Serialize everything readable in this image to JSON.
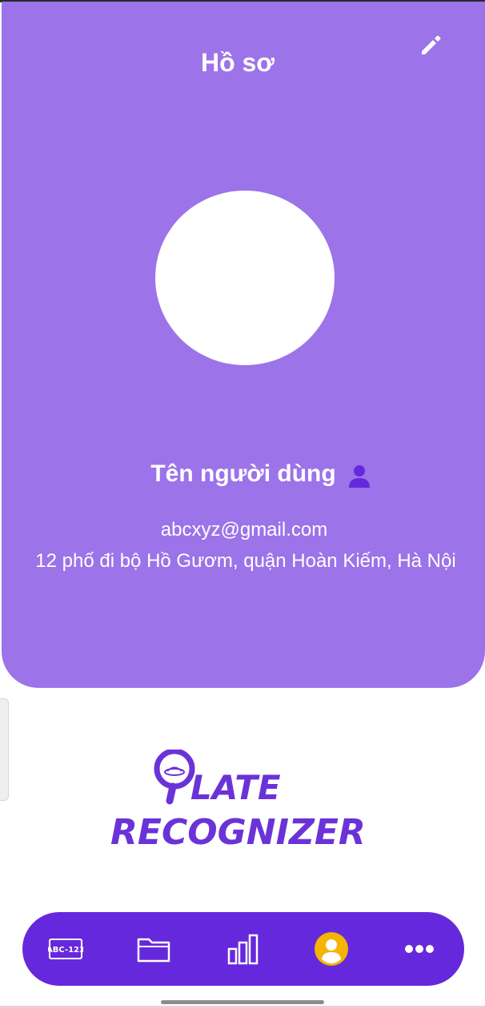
{
  "header": {
    "title": "Hồ sơ",
    "edit_icon": "pencil-icon"
  },
  "profile": {
    "name": "Tên người dùng",
    "name_icon": "user-icon",
    "email": "abcxyz@gmail.com",
    "address": "12 phố đi bộ Hồ Gươm, quận Hoàn Kiếm, Hà Nội"
  },
  "logo": {
    "line1": "LATE",
    "line2": "RECOGNIZER",
    "plate_text": "ABC-123"
  },
  "bottom_nav": {
    "items": [
      {
        "icon": "license-plate-icon",
        "text": "ABC-123"
      },
      {
        "icon": "folder-icon"
      },
      {
        "icon": "bar-chart-icon"
      },
      {
        "icon": "profile-icon",
        "active": true
      },
      {
        "icon": "more-icon"
      }
    ]
  },
  "colors": {
    "card": "#9c73e9",
    "nav": "#6628dc",
    "active": "#f4b400",
    "logo": "#6a33d8"
  }
}
